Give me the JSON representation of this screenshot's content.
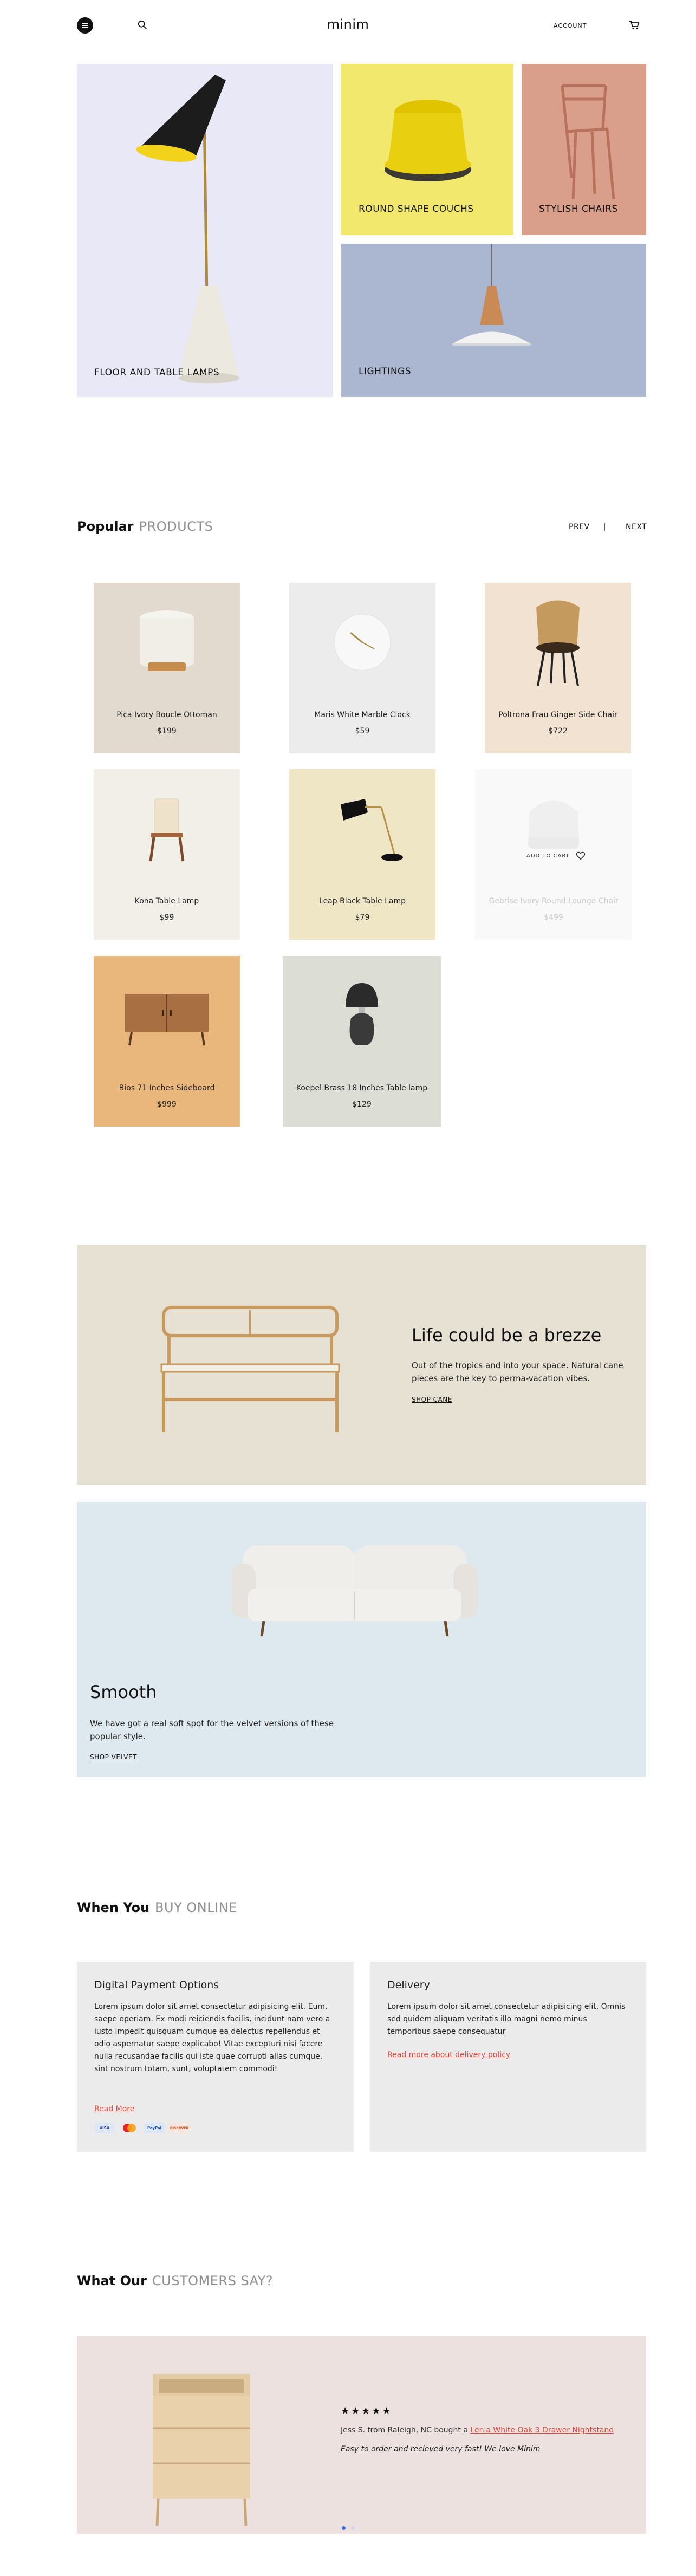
{
  "header": {
    "logo": "minim",
    "account_label": "ACCOUNT"
  },
  "hero": {
    "tiles": [
      {
        "label": "FLOOR AND TABLE LAMPS"
      },
      {
        "label": "ROUND SHAPE COUCHS"
      },
      {
        "label": "STYLISH CHAIRS"
      },
      {
        "label": "LIGHTINGS"
      }
    ]
  },
  "popular": {
    "title_strong": "Popular",
    "title_muted": "PRODUCTS",
    "prev_label": "PREV",
    "separator": "|",
    "next_label": "NEXT",
    "products": [
      {
        "name": "Pica Ivory Boucle Ottoman",
        "price": "$199"
      },
      {
        "name": "Maris White Marble Clock",
        "price": "$59"
      },
      {
        "name": "Poltrona Frau Ginger Side Chair",
        "price": "$722"
      },
      {
        "name": "Kona Table Lamp",
        "price": "$99"
      },
      {
        "name": "Leap Black Table Lamp",
        "price": "$79"
      },
      {
        "name": "Gebrise Ivory Round Lounge Chair",
        "price": "$499",
        "hover_label": "ADD TO CART"
      },
      {
        "name": "Bios 71 Inches Sideboard",
        "price": "$999"
      },
      {
        "name": "Koepel Brass 18 Inches Table lamp",
        "price": "$129"
      }
    ]
  },
  "banners": {
    "cane": {
      "heading": "Life could be a brezze",
      "text": "Out of the tropics and into your space. Natural cane pieces are the key to perma-vacation vibes.",
      "link": "SHOP CANE"
    },
    "velvet": {
      "heading": "Smooth",
      "text": "We have got a real soft spot for the velvet versions of these popular style.",
      "link": "SHOP VELVET"
    }
  },
  "buy_online": {
    "title_strong": "When You",
    "title_muted": "BUY ONLINE",
    "payment": {
      "heading": "Digital Payment Options",
      "text": "Lorem ipsum dolor sit amet consectetur adipisicing elit. Eum, saepe operiam. Ex modi reiciendis facilis, incidunt nam vero a iusto impedit quisquam cumque ea delectus repellendus et odio aspernatur saepe explicabo! Vitae excepturi nisi facere nulla recusandae facilis qui iste quae corrupti alias cumque, sint nostrum totam, sunt, voluptatem commodi!",
      "link": "Read More",
      "methods": [
        "VISA",
        "MC",
        "PayPal",
        "DISCOVER"
      ]
    },
    "delivery": {
      "heading": "Delivery",
      "text": "Lorem ipsum dolor sit amet consectetur adipisicing elit. Omnis sed quidem aliquam veritatis illo magni nemo minus temporibus saepe consequatur",
      "link": "Read more about delivery policy"
    }
  },
  "testimonials": {
    "title_strong": "What Our",
    "title_muted": "CUSTOMERS SAY?",
    "stars": "★★★★★",
    "rating": 5,
    "author_prefix": "Jess S. from Raleigh, NC bought a",
    "product_link": "Lenia White Oak 3 Drawer Nightstand",
    "quote": "Easy to order and recieved very fast! We love Minim"
  },
  "colors": {
    "accent_link": "#e0463c",
    "carousel_active": "#3d6cdf"
  }
}
